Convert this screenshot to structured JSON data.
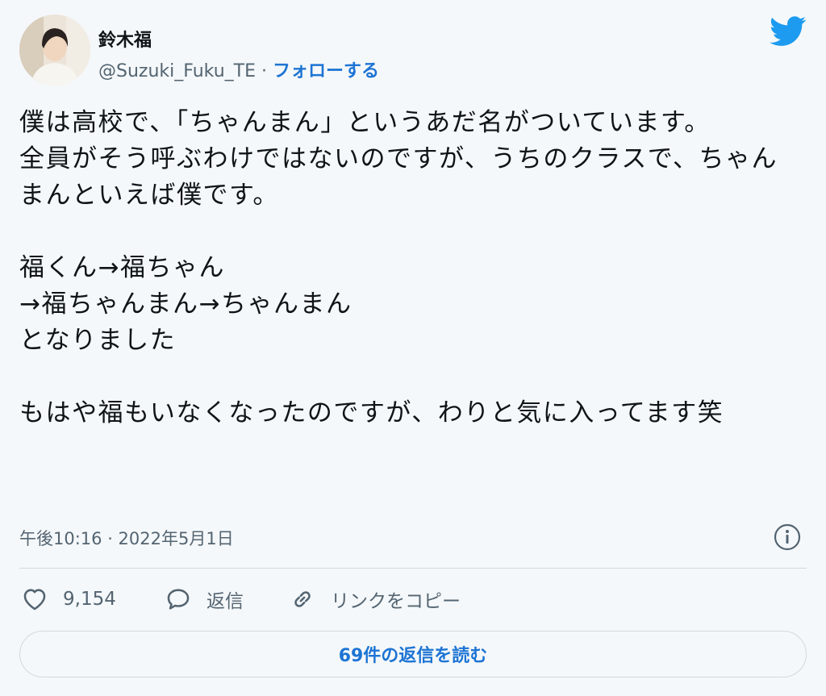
{
  "author": {
    "name": "鈴木福",
    "handle": "@Suzuki_Fuku_TE",
    "separator": " · ",
    "follow_label": "フォローする"
  },
  "icons": {
    "brand": "twitter-bird-icon",
    "info": "info-icon",
    "like": "heart-icon",
    "reply": "speech-bubble-icon",
    "copy_link": "link-icon"
  },
  "colors": {
    "accent": "#1d74d4",
    "twitter_blue": "#1d9bf0",
    "muted": "#536471",
    "background": "#f5f8fa"
  },
  "tweet": {
    "text": "僕は高校で、「ちゃんまん」というあだ名がついています。\n全員がそう呼ぶわけではないのですが、うちのクラスで、ちゃんまんといえば僕です。\n\n福くん→福ちゃん\n→福ちゃんまん→ちゃんまん\nとなりました\n\nもはや福もいなくなったのですが、わりと気に入ってます笑",
    "timestamp": "午後10:16 · 2022年5月1日"
  },
  "actions": {
    "like_count": "9,154",
    "reply_label": "返信",
    "copy_link_label": "リンクをコピー"
  },
  "read_replies_label": "69件の返信を読む"
}
